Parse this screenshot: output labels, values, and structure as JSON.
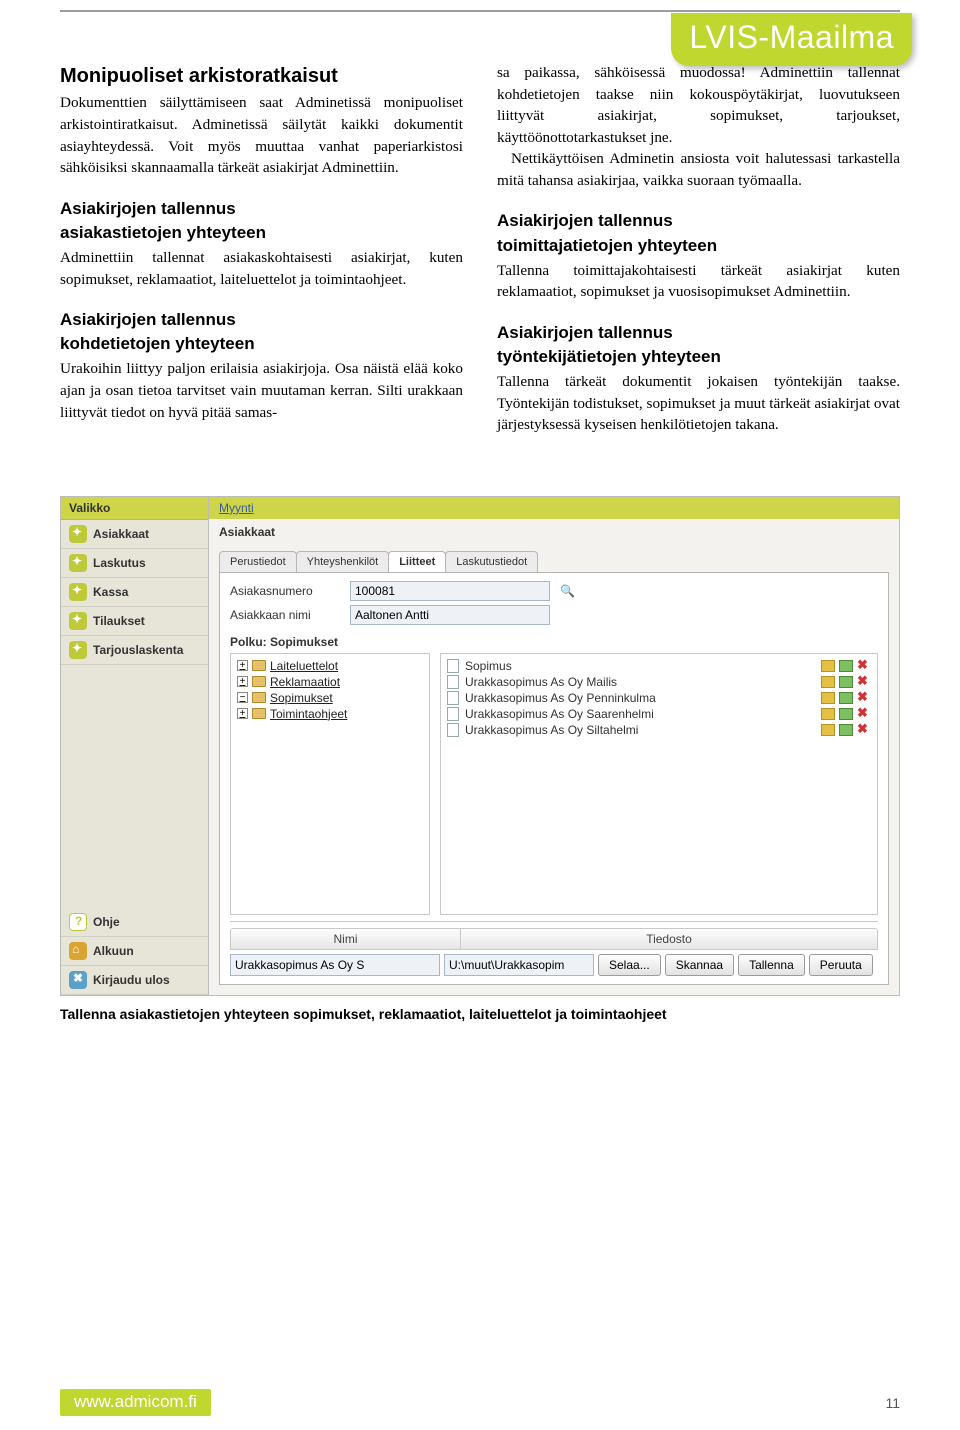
{
  "badge": "LVIS-Maailma",
  "article": {
    "left": {
      "h1": "Monipuoliset arkistoratkaisut",
      "p1": "Dokumenttien säilyttämiseen saat Adminetissä monipuoliset arkistointiratkaisut. Adminetissä säilytät kaikki dokumentit asiayhteydessä. Voit myös muuttaa vanhat paperiarkistosi sähköisiksi skannaamalla tärkeät asiakirjat Adminettiin.",
      "h2a": "Asiakirjojen tallennus",
      "h2a_sub": "asiakastietojen yhteyteen",
      "p2": "Adminettiin tallennat asiakaskohtaisesti asiakirjat, kuten sopimukset, reklamaatiot, laiteluettelot ja toimintaohjeet.",
      "h2b": "Asiakirjojen tallennus",
      "h2b_sub": "kohdetietojen yhteyteen",
      "p3": "Urakoihin liittyy paljon erilaisia asiakirjoja. Osa näistä elää koko ajan ja osan tietoa tarvitset vain muutaman kerran. Silti urakkaan liittyvät tiedot on hyvä pitää samas-"
    },
    "right": {
      "p1": "sa paikassa, sähköisessä muodossa! Adminettiin tallennat kohdetietojen taakse niin kokouspöytäkirjat, luovutukseen liittyvät asiakirjat, sopimukset, tarjoukset, käyttöönottotarkastukset jne.",
      "p1b": "Nettikäyttöisen Adminetin ansiosta voit halutessasi tarkastella mitä tahansa asiakirjaa, vaikka suoraan työmaalla.",
      "h2a": "Asiakirjojen tallennus",
      "h2a_sub": "toimittajatietojen yhteyteen",
      "p2": "Tallenna toimittajakohtaisesti tärkeät asiakirjat kuten reklamaatiot, sopimukset ja vuosisopimukset Adminettiin.",
      "h2b": "Asiakirjojen tallennus",
      "h2b_sub": "työntekijätietojen yhteyteen",
      "p3": "Tallenna tärkeät dokumentit jokaisen työntekijän taakse. Työntekijän todistukset, sopimukset ja muut tärkeät asiakirjat ovat järjestyksessä kyseisen henkilötietojen takana."
    }
  },
  "app": {
    "sidebar_title": "Valikko",
    "menu": [
      "Asiakkaat",
      "Laskutus",
      "Kassa",
      "Tilaukset",
      "Tarjouslaskenta"
    ],
    "menu2": [
      {
        "icon": "help",
        "label": "Ohje"
      },
      {
        "icon": "home",
        "label": "Alkuun"
      },
      {
        "icon": "logout",
        "label": "Kirjaudu ulos"
      }
    ],
    "crumbs": "Myynti",
    "section": "Asiakkaat",
    "tabs": [
      "Perustiedot",
      "Yhteyshenkilöt",
      "Liitteet",
      "Laskutustiedot"
    ],
    "active_tab": 2,
    "fields": {
      "num_label": "Asiakasnumero",
      "num_value": "100081",
      "name_label": "Asiakkaan nimi",
      "name_value": "Aaltonen Antti"
    },
    "path_label": "Polku: Sopimukset",
    "tree": [
      {
        "toggle": "+",
        "label": "Laiteluettelot"
      },
      {
        "toggle": "+",
        "label": "Reklamaatiot"
      },
      {
        "toggle": "−",
        "label": "Sopimukset"
      },
      {
        "toggle": "+",
        "label": "Toimintaohjeet"
      }
    ],
    "files": [
      "Sopimus",
      "Urakkasopimus As Oy Mailis",
      "Urakkasopimus As Oy Penninkulma",
      "Urakkasopimus As Oy Saarenhelmi",
      "Urakkasopimus As Oy Siltahelmi"
    ],
    "bottom": {
      "col_nimi": "Nimi",
      "col_tied": "Tiedosto",
      "nimi_value": "Urakkasopimus As Oy S",
      "tied_value": "U:\\muut\\Urakkasopim",
      "buttons": [
        "Selaa...",
        "Skannaa",
        "Tallenna",
        "Peruuta"
      ]
    }
  },
  "caption": "Tallenna asiakastietojen yhteyteen sopimukset, reklamaatiot, laiteluettelot ja toimintaohjeet",
  "footer_url": "www.admicom.fi",
  "footer_page": "11"
}
